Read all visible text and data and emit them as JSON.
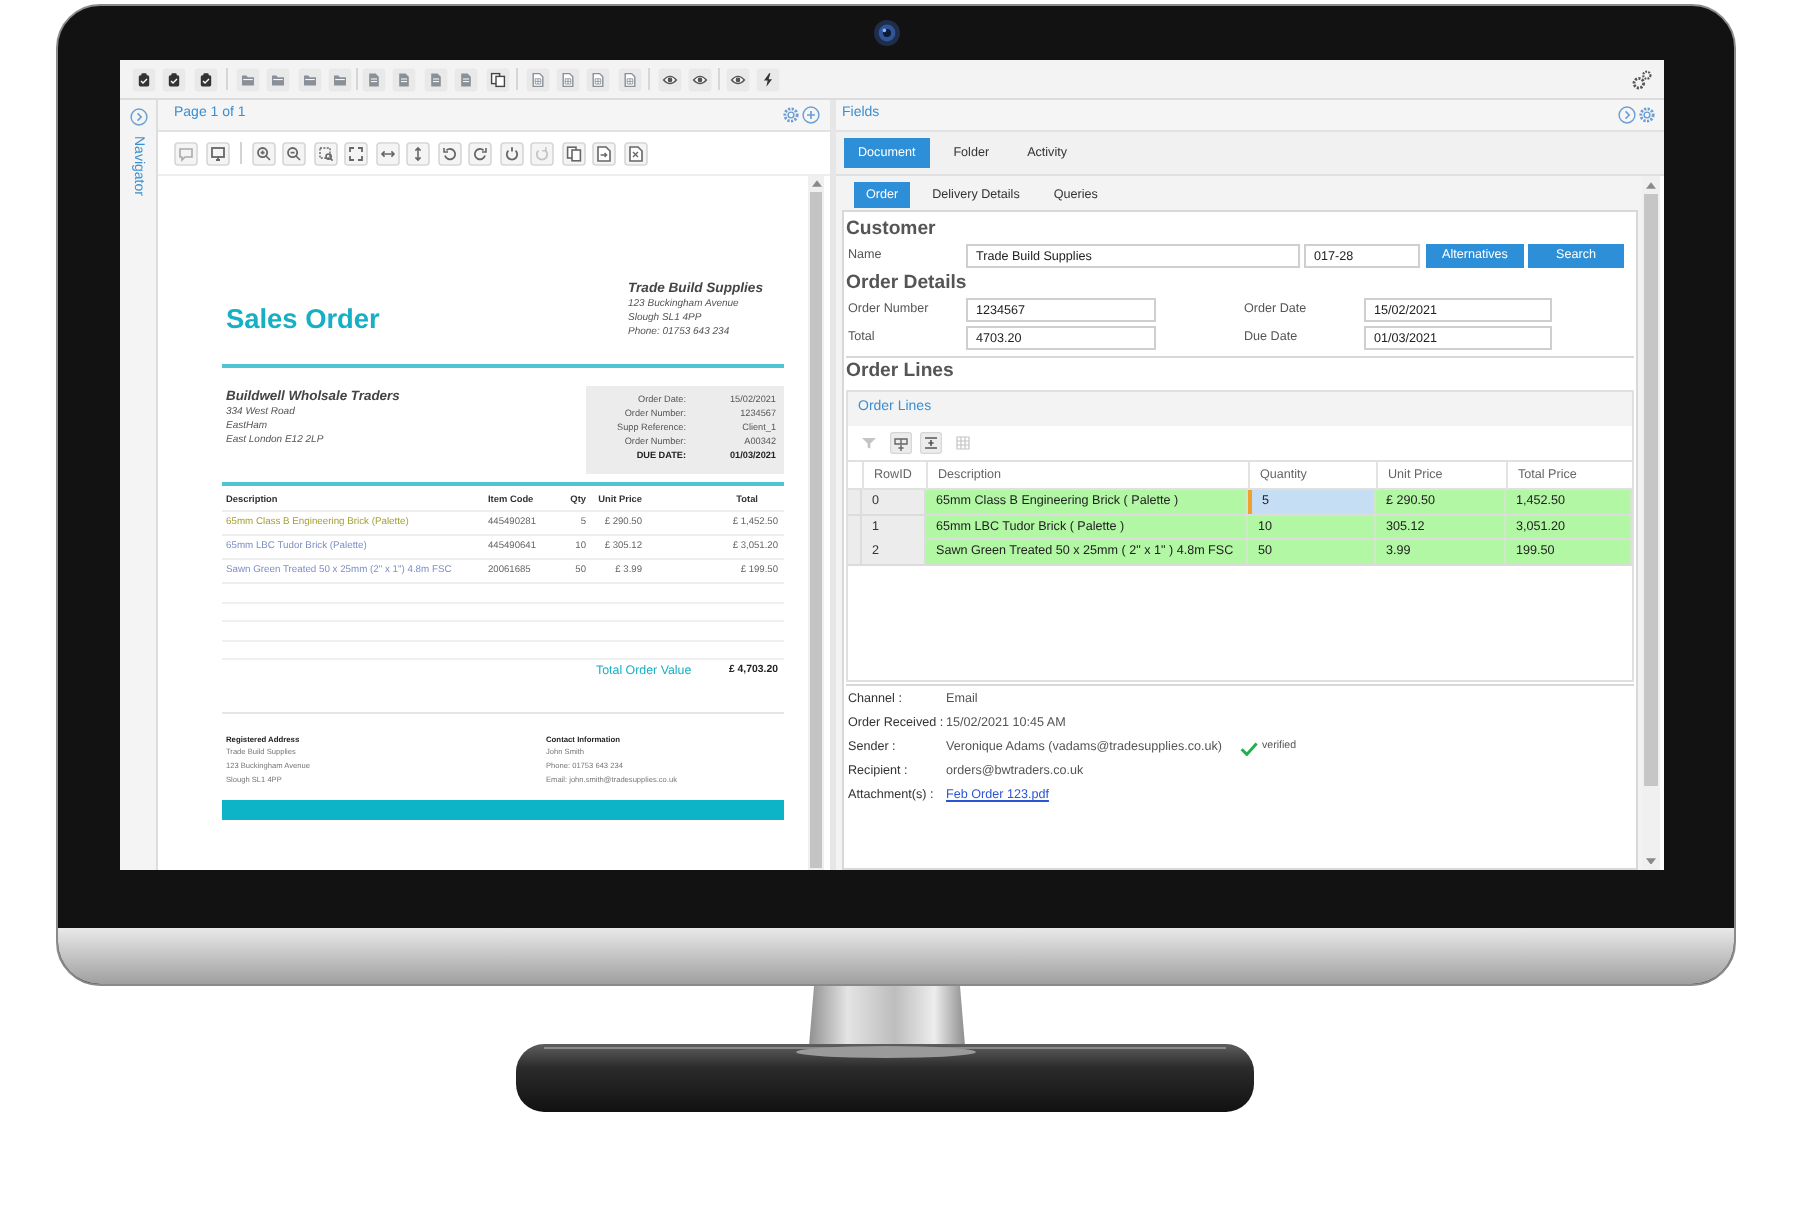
{
  "navigator": {
    "label": "Navigator"
  },
  "document_panel": {
    "title": "Page 1 of 1"
  },
  "document": {
    "title": "Sales Order",
    "supplier": {
      "name": "Trade Build Supplies",
      "lines": [
        "123 Buckingham Avenue",
        "Slough SL1 4PP",
        "Phone: 01753 643 234"
      ]
    },
    "customer": {
      "name": "Buildwell Wholsale Traders",
      "lines": [
        "334 West Road",
        "EastHam",
        "East London E12 2LP"
      ]
    },
    "details": [
      {
        "label": "Order Date:",
        "value": "15/02/2021",
        "bold": false
      },
      {
        "label": "Order Number:",
        "value": "1234567",
        "bold": false
      },
      {
        "label": "Supp Reference:",
        "value": "Client_1",
        "bold": false
      },
      {
        "label": "Order Number:",
        "value": "A00342",
        "bold": false
      },
      {
        "label": "DUE DATE:",
        "value": "01/03/2021",
        "bold": true
      }
    ],
    "columns": [
      "Description",
      "Item Code",
      "Qty",
      "Unit Price",
      "Total"
    ],
    "lines": [
      {
        "description": "65mm Class B Engineering Brick (Palette)",
        "color": "#a59f30",
        "item_code": "445490281",
        "qty": "5",
        "unit_price": "£ 290.50",
        "total": "£ 1,452.50"
      },
      {
        "description": "65mm LBC Tudor Brick (Palette)",
        "color": "#7d8fc6",
        "item_code": "445490641",
        "qty": "10",
        "unit_price": "£ 305.12",
        "total": "£ 3,051.20"
      },
      {
        "description": "Sawn Green Treated 50 x 25mm (2\" x 1\") 4.8m FSC",
        "color": "#7d8fc6",
        "item_code": "20061685",
        "qty": "50",
        "unit_price": "£ 3.99",
        "total": "£ 199.50"
      }
    ],
    "total": {
      "label": "Total Order Value",
      "value": "£ 4,703.20"
    },
    "footer": [
      {
        "heading": "Registered Address",
        "lines": [
          "Trade Build Supplies",
          "123 Buckingham Avenue",
          "Slough SL1 4PP"
        ]
      },
      {
        "heading": "Contact Information",
        "lines": [
          "John Smith",
          "Phone: 01753 643 234",
          "Email: john.smith@tradesupplies.co.uk"
        ]
      }
    ]
  },
  "fields_panel": {
    "title": "Fields",
    "tabs": [
      {
        "label": "Document",
        "selected": true
      },
      {
        "label": "Folder",
        "selected": false
      },
      {
        "label": "Activity",
        "selected": false
      }
    ],
    "subtabs": [
      {
        "label": "Order",
        "selected": true
      },
      {
        "label": "Delivery Details",
        "selected": false
      },
      {
        "label": "Queries",
        "selected": false
      }
    ],
    "customer": {
      "heading": "Customer",
      "label": "Name",
      "name": "Trade Build Supplies",
      "code": "017-28",
      "buttons": [
        "Alternatives",
        "Search"
      ]
    },
    "order_details": {
      "heading": "Order Details",
      "fields": [
        {
          "label": "Order Number",
          "value": "1234567"
        },
        {
          "label": "Order Date",
          "value": "15/02/2021"
        },
        {
          "label": "Total",
          "value": "4703.20"
        },
        {
          "label": "Due Date",
          "value": "01/03/2021"
        }
      ]
    },
    "order_lines": {
      "heading": "Order Lines",
      "panel_title": "Order Lines",
      "columns": [
        "RowID",
        "Description",
        "Quantity",
        "Unit Price",
        "Total Price"
      ],
      "rows": [
        {
          "row_id": "0",
          "description": "65mm Class B Engineering Brick ( Palette )",
          "quantity": "5",
          "unit_price": "£ 290.50",
          "total_price": "1,452.50",
          "validated": true,
          "quantity_focused": true
        },
        {
          "row_id": "1",
          "description": "65mm LBC Tudor Brick ( Palette )",
          "quantity": "10",
          "unit_price": "305.12",
          "total_price": "3,051.20",
          "validated": true,
          "quantity_focused": false
        },
        {
          "row_id": "2",
          "description": "Sawn Green Treated 50 x 25mm ( 2\" x 1\" ) 4.8m FSC",
          "quantity": "50",
          "unit_price": "3.99",
          "total_price": "199.50",
          "validated": true,
          "quantity_focused": false
        }
      ]
    },
    "info": [
      {
        "label": "Channel :",
        "value": "Email",
        "kind": "text"
      },
      {
        "label": "Order Received :",
        "value": "15/02/2021 10:45 AM",
        "kind": "text"
      },
      {
        "label": "Sender :",
        "value": "Veronique Adams (vadams@tradesupplies.co.uk)",
        "kind": "text",
        "badge": "verified"
      },
      {
        "label": "Recipient :",
        "value": "orders@bwtraders.co.uk",
        "kind": "text"
      },
      {
        "label": "Attachment(s) :",
        "value": "Feb Order 123.pdf",
        "kind": "link"
      }
    ]
  }
}
